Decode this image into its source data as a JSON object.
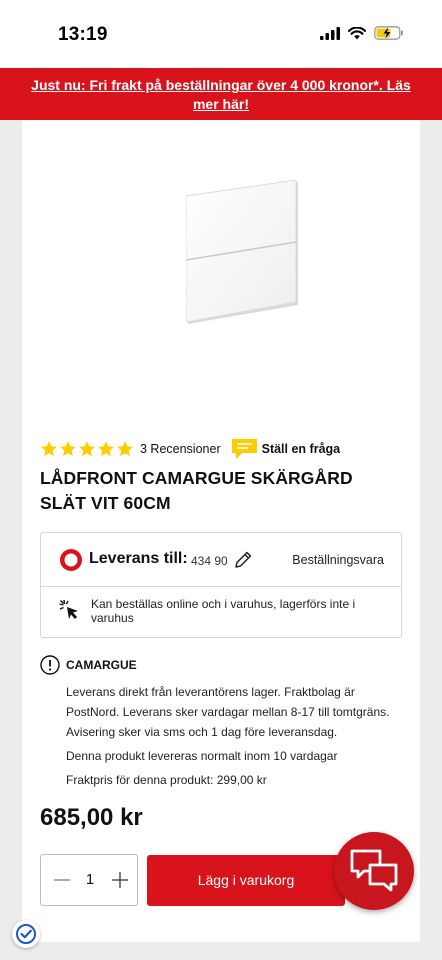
{
  "status_bar": {
    "time": "13:19",
    "icons": [
      "signal-icon",
      "wifi-icon",
      "battery-charging-icon"
    ]
  },
  "promo": {
    "text": "Just nu: Fri frakt på beställningar över 4 000 kronor*. Läs mer här!"
  },
  "product": {
    "image_icon": "drawer-front-image",
    "rating": 5,
    "reviews_label": "3 Recensioner",
    "ask_label": "Ställ en fråga",
    "title": "LÅDFRONT CAMARGUE SKÄRGÅRD SLÄT VIT 60CM",
    "price": "685,00 kr"
  },
  "delivery": {
    "label": "Leverans till:",
    "postcode": "434 90",
    "order_type": "Beställningsvara",
    "availability": "Kan beställas online och i varuhus, lagerförs inte i varuhus"
  },
  "supplier_info": {
    "name": "CAMARGUE",
    "paragraphs": [
      "Leverans direkt från leverantörens lager. Fraktbolag är PostNord. Leverans sker vardagar mellan 8-17 till tomtgräns. Avisering sker via sms och 1 dag före leveransdag.",
      "Denna produkt levereras normalt inom 10 vardagar",
      "Fraktpris för denna produkt: 299,00 kr"
    ]
  },
  "purchase": {
    "quantity": "1",
    "add_to_cart_label": "Lägg i varukorg"
  },
  "colors": {
    "brand_red": "#d8131c",
    "star_yellow": "#ffcc00"
  }
}
